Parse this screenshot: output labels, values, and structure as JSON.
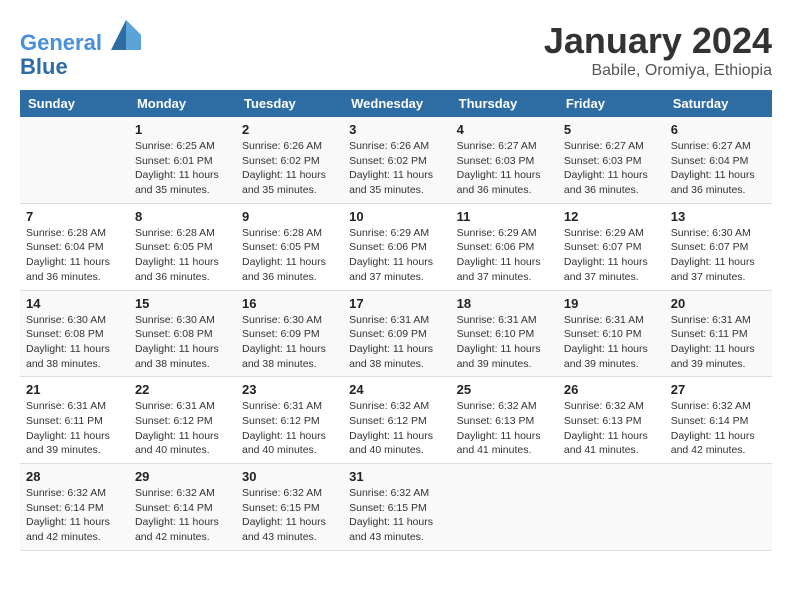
{
  "logo": {
    "line1": "General",
    "line2": "Blue"
  },
  "title": "January 2024",
  "subtitle": "Babile, Oromiya, Ethiopia",
  "columns": [
    "Sunday",
    "Monday",
    "Tuesday",
    "Wednesday",
    "Thursday",
    "Friday",
    "Saturday"
  ],
  "weeks": [
    [
      {
        "day": "",
        "sunrise": "",
        "sunset": "",
        "daylight": ""
      },
      {
        "day": "1",
        "sunrise": "Sunrise: 6:25 AM",
        "sunset": "Sunset: 6:01 PM",
        "daylight": "Daylight: 11 hours and 35 minutes."
      },
      {
        "day": "2",
        "sunrise": "Sunrise: 6:26 AM",
        "sunset": "Sunset: 6:02 PM",
        "daylight": "Daylight: 11 hours and 35 minutes."
      },
      {
        "day": "3",
        "sunrise": "Sunrise: 6:26 AM",
        "sunset": "Sunset: 6:02 PM",
        "daylight": "Daylight: 11 hours and 35 minutes."
      },
      {
        "day": "4",
        "sunrise": "Sunrise: 6:27 AM",
        "sunset": "Sunset: 6:03 PM",
        "daylight": "Daylight: 11 hours and 36 minutes."
      },
      {
        "day": "5",
        "sunrise": "Sunrise: 6:27 AM",
        "sunset": "Sunset: 6:03 PM",
        "daylight": "Daylight: 11 hours and 36 minutes."
      },
      {
        "day": "6",
        "sunrise": "Sunrise: 6:27 AM",
        "sunset": "Sunset: 6:04 PM",
        "daylight": "Daylight: 11 hours and 36 minutes."
      }
    ],
    [
      {
        "day": "7",
        "sunrise": "Sunrise: 6:28 AM",
        "sunset": "Sunset: 6:04 PM",
        "daylight": "Daylight: 11 hours and 36 minutes."
      },
      {
        "day": "8",
        "sunrise": "Sunrise: 6:28 AM",
        "sunset": "Sunset: 6:05 PM",
        "daylight": "Daylight: 11 hours and 36 minutes."
      },
      {
        "day": "9",
        "sunrise": "Sunrise: 6:28 AM",
        "sunset": "Sunset: 6:05 PM",
        "daylight": "Daylight: 11 hours and 36 minutes."
      },
      {
        "day": "10",
        "sunrise": "Sunrise: 6:29 AM",
        "sunset": "Sunset: 6:06 PM",
        "daylight": "Daylight: 11 hours and 37 minutes."
      },
      {
        "day": "11",
        "sunrise": "Sunrise: 6:29 AM",
        "sunset": "Sunset: 6:06 PM",
        "daylight": "Daylight: 11 hours and 37 minutes."
      },
      {
        "day": "12",
        "sunrise": "Sunrise: 6:29 AM",
        "sunset": "Sunset: 6:07 PM",
        "daylight": "Daylight: 11 hours and 37 minutes."
      },
      {
        "day": "13",
        "sunrise": "Sunrise: 6:30 AM",
        "sunset": "Sunset: 6:07 PM",
        "daylight": "Daylight: 11 hours and 37 minutes."
      }
    ],
    [
      {
        "day": "14",
        "sunrise": "Sunrise: 6:30 AM",
        "sunset": "Sunset: 6:08 PM",
        "daylight": "Daylight: 11 hours and 38 minutes."
      },
      {
        "day": "15",
        "sunrise": "Sunrise: 6:30 AM",
        "sunset": "Sunset: 6:08 PM",
        "daylight": "Daylight: 11 hours and 38 minutes."
      },
      {
        "day": "16",
        "sunrise": "Sunrise: 6:30 AM",
        "sunset": "Sunset: 6:09 PM",
        "daylight": "Daylight: 11 hours and 38 minutes."
      },
      {
        "day": "17",
        "sunrise": "Sunrise: 6:31 AM",
        "sunset": "Sunset: 6:09 PM",
        "daylight": "Daylight: 11 hours and 38 minutes."
      },
      {
        "day": "18",
        "sunrise": "Sunrise: 6:31 AM",
        "sunset": "Sunset: 6:10 PM",
        "daylight": "Daylight: 11 hours and 39 minutes."
      },
      {
        "day": "19",
        "sunrise": "Sunrise: 6:31 AM",
        "sunset": "Sunset: 6:10 PM",
        "daylight": "Daylight: 11 hours and 39 minutes."
      },
      {
        "day": "20",
        "sunrise": "Sunrise: 6:31 AM",
        "sunset": "Sunset: 6:11 PM",
        "daylight": "Daylight: 11 hours and 39 minutes."
      }
    ],
    [
      {
        "day": "21",
        "sunrise": "Sunrise: 6:31 AM",
        "sunset": "Sunset: 6:11 PM",
        "daylight": "Daylight: 11 hours and 39 minutes."
      },
      {
        "day": "22",
        "sunrise": "Sunrise: 6:31 AM",
        "sunset": "Sunset: 6:12 PM",
        "daylight": "Daylight: 11 hours and 40 minutes."
      },
      {
        "day": "23",
        "sunrise": "Sunrise: 6:31 AM",
        "sunset": "Sunset: 6:12 PM",
        "daylight": "Daylight: 11 hours and 40 minutes."
      },
      {
        "day": "24",
        "sunrise": "Sunrise: 6:32 AM",
        "sunset": "Sunset: 6:12 PM",
        "daylight": "Daylight: 11 hours and 40 minutes."
      },
      {
        "day": "25",
        "sunrise": "Sunrise: 6:32 AM",
        "sunset": "Sunset: 6:13 PM",
        "daylight": "Daylight: 11 hours and 41 minutes."
      },
      {
        "day": "26",
        "sunrise": "Sunrise: 6:32 AM",
        "sunset": "Sunset: 6:13 PM",
        "daylight": "Daylight: 11 hours and 41 minutes."
      },
      {
        "day": "27",
        "sunrise": "Sunrise: 6:32 AM",
        "sunset": "Sunset: 6:14 PM",
        "daylight": "Daylight: 11 hours and 42 minutes."
      }
    ],
    [
      {
        "day": "28",
        "sunrise": "Sunrise: 6:32 AM",
        "sunset": "Sunset: 6:14 PM",
        "daylight": "Daylight: 11 hours and 42 minutes."
      },
      {
        "day": "29",
        "sunrise": "Sunrise: 6:32 AM",
        "sunset": "Sunset: 6:14 PM",
        "daylight": "Daylight: 11 hours and 42 minutes."
      },
      {
        "day": "30",
        "sunrise": "Sunrise: 6:32 AM",
        "sunset": "Sunset: 6:15 PM",
        "daylight": "Daylight: 11 hours and 43 minutes."
      },
      {
        "day": "31",
        "sunrise": "Sunrise: 6:32 AM",
        "sunset": "Sunset: 6:15 PM",
        "daylight": "Daylight: 11 hours and 43 minutes."
      },
      {
        "day": "",
        "sunrise": "",
        "sunset": "",
        "daylight": ""
      },
      {
        "day": "",
        "sunrise": "",
        "sunset": "",
        "daylight": ""
      },
      {
        "day": "",
        "sunrise": "",
        "sunset": "",
        "daylight": ""
      }
    ]
  ]
}
